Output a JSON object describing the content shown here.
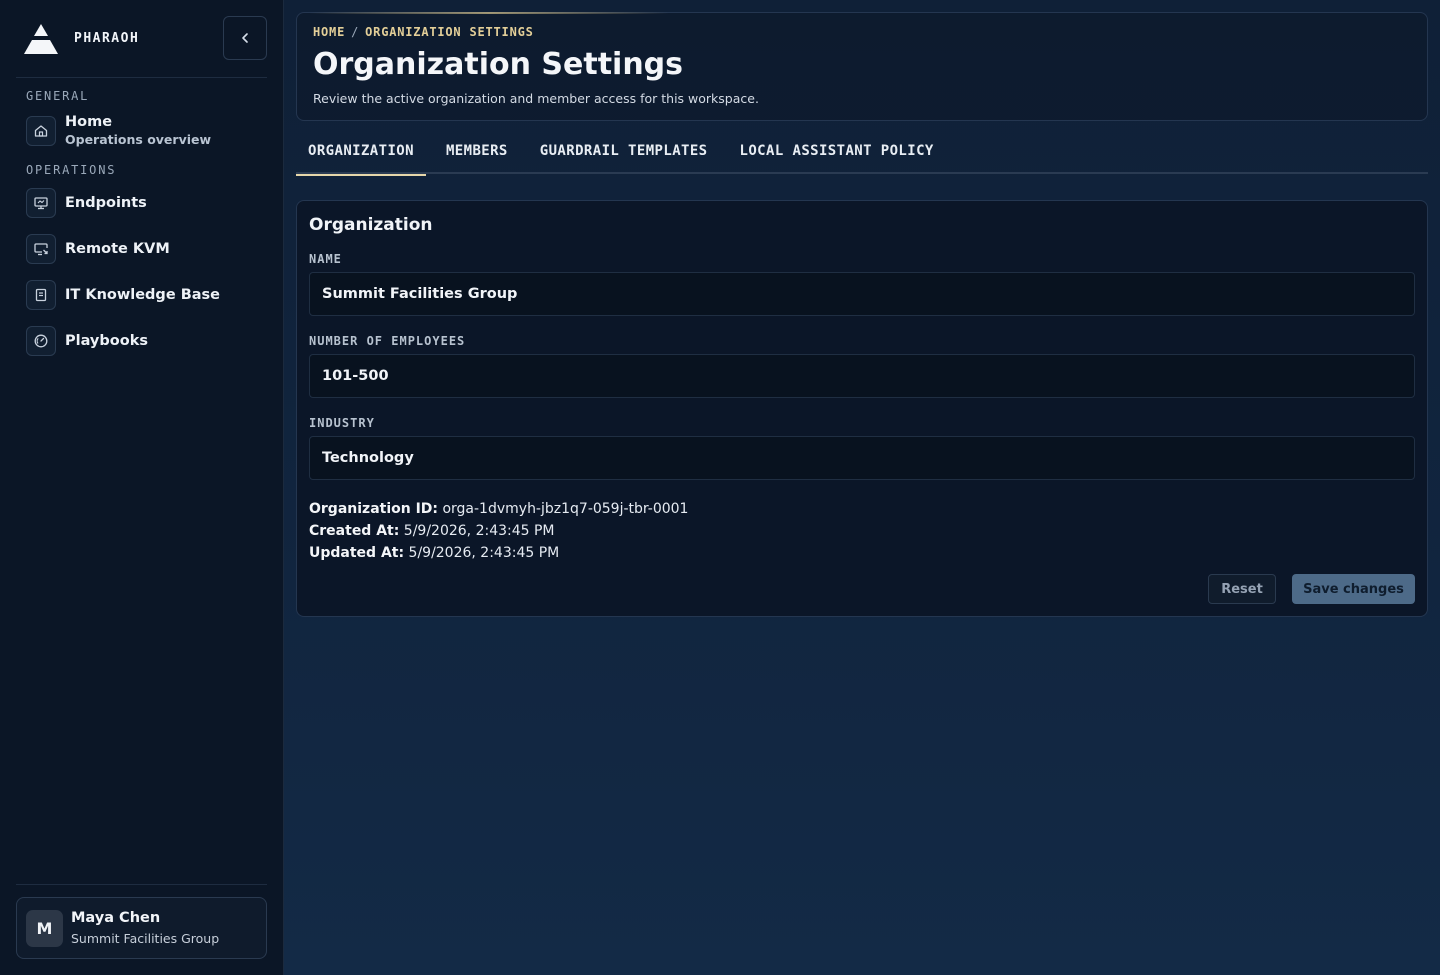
{
  "brand": {
    "name": "PHARAOH"
  },
  "sidebar": {
    "sections": [
      {
        "label": "GENERAL",
        "items": [
          {
            "title": "Home",
            "subtitle": "Operations overview",
            "icon": "home-icon"
          }
        ]
      },
      {
        "label": "OPERATIONS",
        "items": [
          {
            "title": "Endpoints",
            "icon": "monitor-icon"
          },
          {
            "title": "Remote KVM",
            "icon": "remote-screen-icon"
          },
          {
            "title": "IT Knowledge Base",
            "icon": "book-icon"
          },
          {
            "title": "Playbooks",
            "icon": "gauge-icon"
          }
        ]
      }
    ],
    "collapse_icon": "chevron-left-icon"
  },
  "user": {
    "initial": "M",
    "name": "Maya Chen",
    "org": "Summit Facilities Group"
  },
  "header": {
    "breadcrumb": [
      "HOME",
      "ORGANIZATION SETTINGS"
    ],
    "breadcrumb_sep": "/",
    "title": "Organization Settings",
    "description": "Review the active organization and member access for this workspace."
  },
  "tabs": [
    {
      "label": "ORGANIZATION",
      "active": true
    },
    {
      "label": "MEMBERS",
      "active": false
    },
    {
      "label": "GUARDRAIL TEMPLATES",
      "active": false
    },
    {
      "label": "LOCAL ASSISTANT POLICY",
      "active": false
    }
  ],
  "organization": {
    "card_title": "Organization",
    "fields": {
      "name": {
        "label": "NAME",
        "value": "Summit Facilities Group"
      },
      "employees": {
        "label": "NUMBER OF EMPLOYEES",
        "value": "101-500"
      },
      "industry": {
        "label": "INDUSTRY",
        "value": "Technology"
      }
    },
    "meta": {
      "id": {
        "label": "Organization ID:",
        "value": "orga-1dvmyh-jbz1q7-059j-tbr-0001"
      },
      "created": {
        "label": "Created At:",
        "value": "5/9/2026, 2:43:45 PM"
      },
      "updated": {
        "label": "Updated At:",
        "value": "5/9/2026, 2:43:45 PM"
      }
    },
    "reset_label": "Reset",
    "save_label": "Save changes"
  },
  "colors": {
    "accent_gold": "#e3cf98",
    "save_button": "#4d6a88",
    "background": "#0d1b2e"
  }
}
